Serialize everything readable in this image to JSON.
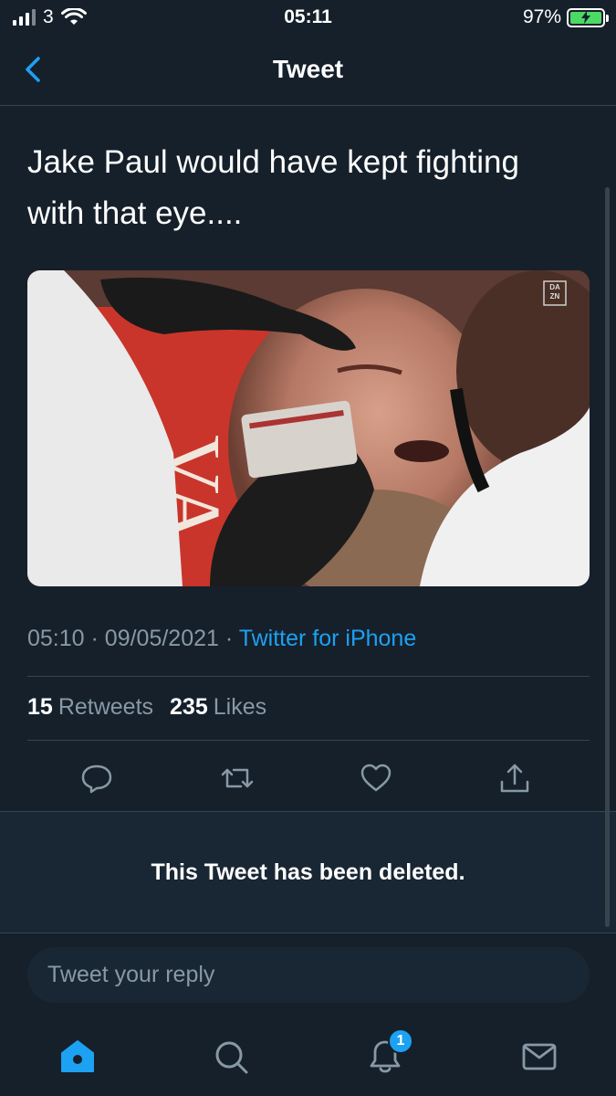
{
  "status_bar": {
    "carrier": "3",
    "time": "05:11",
    "battery": "97%"
  },
  "nav": {
    "title": "Tweet"
  },
  "tweet": {
    "text": "Jake Paul would have kept fighting with that eye....",
    "media_watermark": "DA ZN",
    "time": "05:10",
    "date": "09/05/2021",
    "source": "Twitter for iPhone",
    "retweets_count": "15",
    "retweets_label": "Retweets",
    "likes_count": "235",
    "likes_label": "Likes"
  },
  "deleted_notice": "This Tweet has been deleted.",
  "reply": {
    "placeholder": "Tweet your reply"
  },
  "tabbar": {
    "notifications_badge": "1"
  },
  "colors": {
    "background": "#15202b",
    "accent": "#1da1f2",
    "muted": "#8899a6",
    "divider": "#38444d"
  }
}
